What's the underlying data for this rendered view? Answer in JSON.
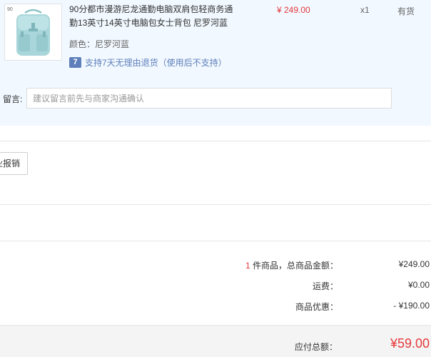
{
  "product": {
    "title": "90分都市漫游尼龙通勤电脑双肩包轻商务通勤13英寸14英寸电脑包女士背包 尼罗河蓝",
    "price": "¥ 249.00",
    "quantity": "x1",
    "stock": "有货",
    "color": "颜色：尼罗河蓝",
    "return_icon": "7",
    "return_policy": "支持7天无理由退货（使用后不支持）",
    "thumb_brand": "90"
  },
  "message": {
    "label": "留言:",
    "placeholder": "建议留言前先与商家沟通确认"
  },
  "invoice": {
    "button_label": "开企业报销"
  },
  "summary": {
    "count": "1",
    "count_suffix": " 件商品，总商品金额：",
    "goods_total": "¥249.00",
    "shipping_label": "运费：",
    "shipping_value": "¥0.00",
    "discount_label": "商品优惠：",
    "discount_value": "- ¥190.00",
    "payable_label": "应付总额：",
    "payable_value": "¥59.00"
  },
  "colors": {
    "accent_red": "#e4393c",
    "link_blue": "#5e7fba",
    "panel_bg": "#f1f8ff",
    "bag_color": "#a9d6da"
  },
  "icons": {
    "return_badge": "seven-day-return-icon",
    "product_image": "backpack-image"
  }
}
